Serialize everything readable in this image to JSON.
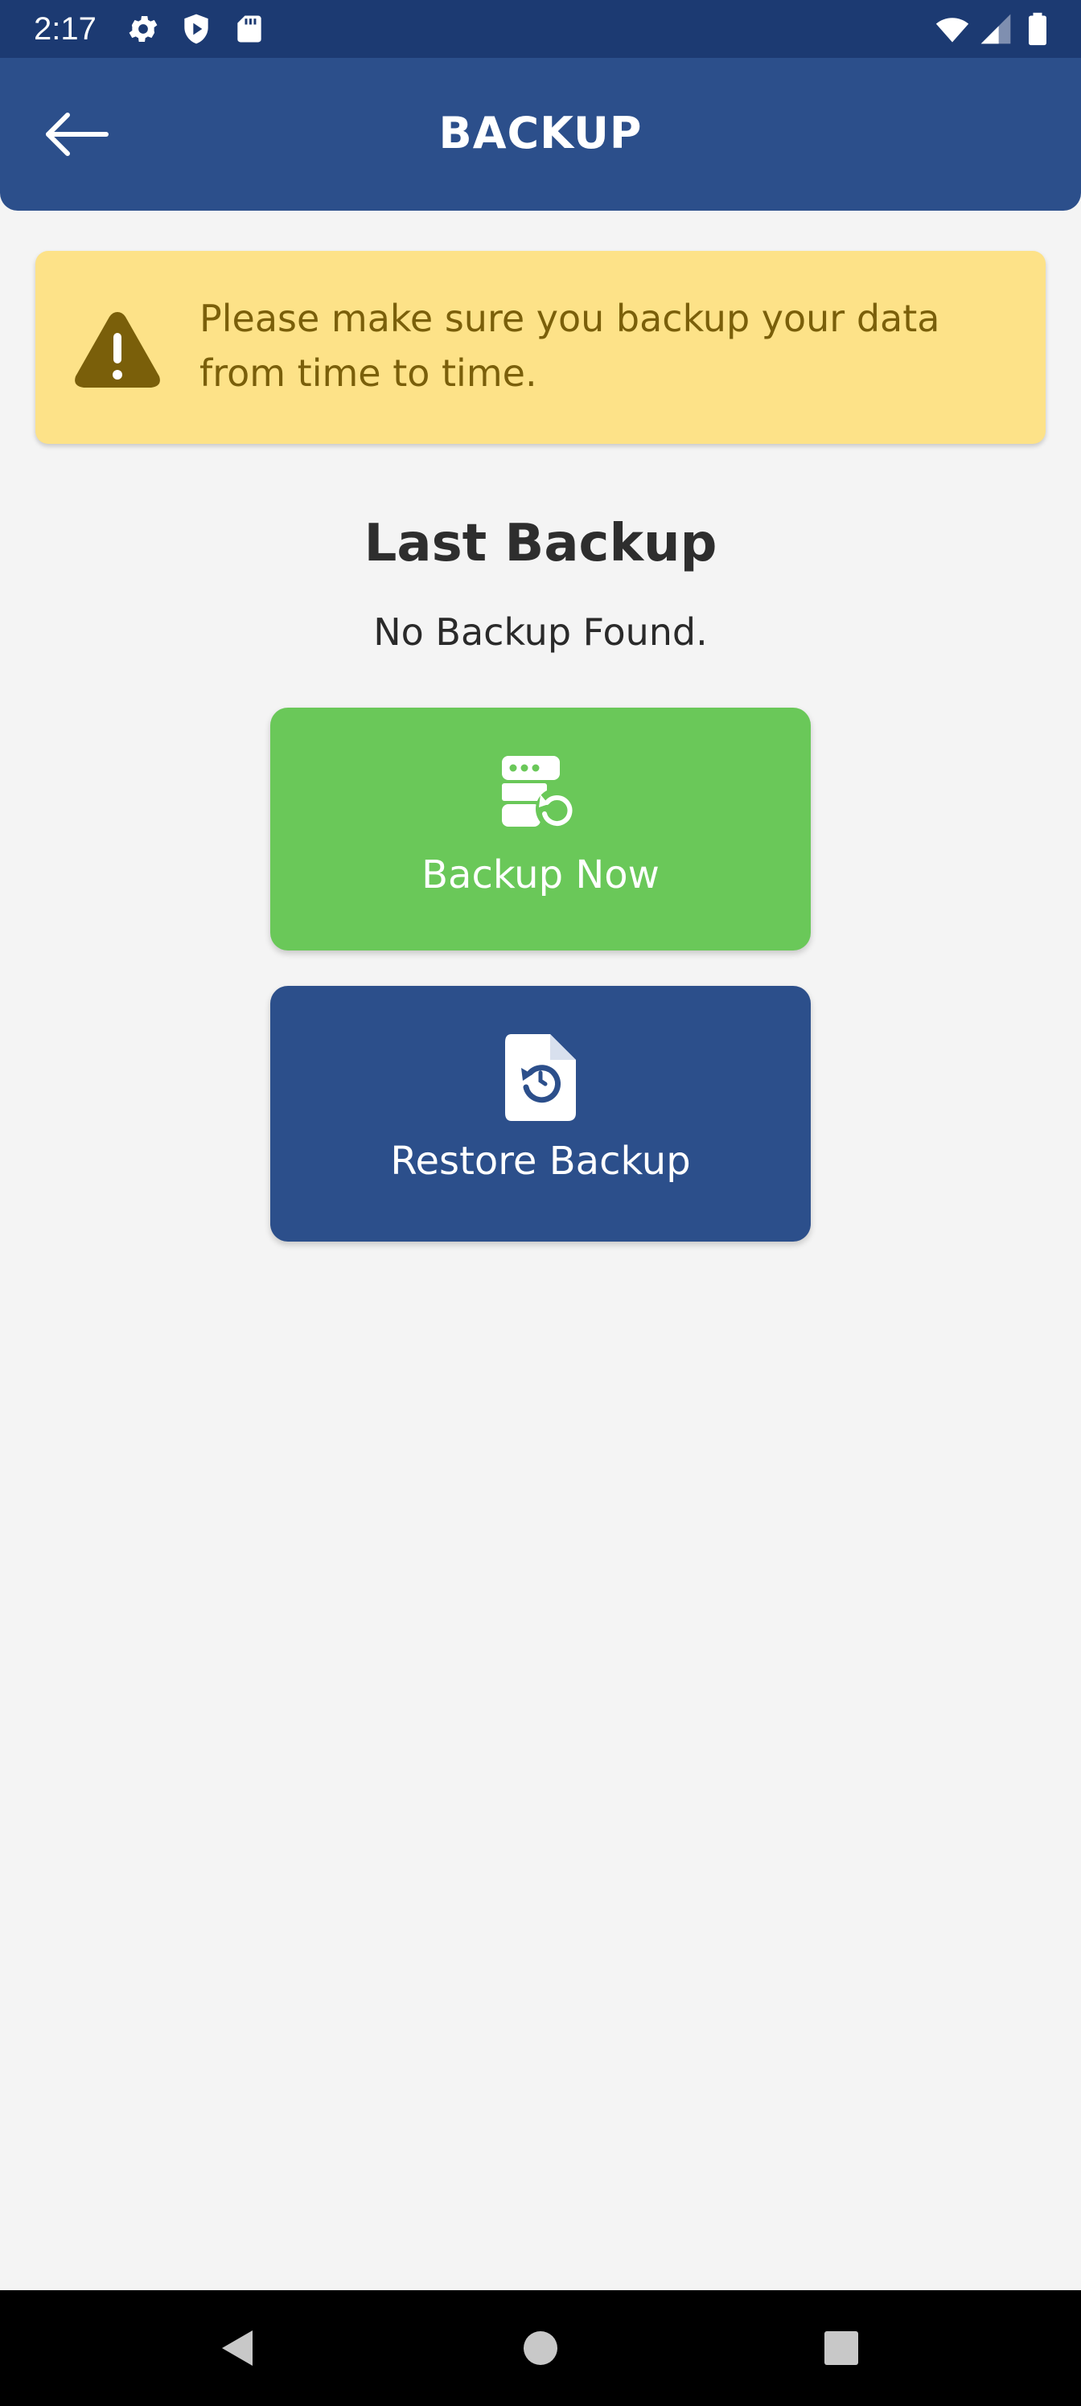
{
  "status_bar": {
    "time": "2:17",
    "icons": [
      "gear-icon",
      "shield-play-icon",
      "sd-card-icon",
      "wifi-icon",
      "cell-signal-icon",
      "battery-icon"
    ]
  },
  "app_bar": {
    "title": "BACKUP",
    "back_icon": "arrow-left-icon"
  },
  "warning": {
    "icon": "warning-triangle-icon",
    "message": "Please make sure you backup your data from time to time."
  },
  "last_backup": {
    "title": "Last Backup",
    "status": "No Backup Found."
  },
  "actions": {
    "backup_now": {
      "label": "Backup Now",
      "icon": "server-restore-icon",
      "color": "#6ac859"
    },
    "restore_backup": {
      "label": "Restore Backup",
      "icon": "file-restore-icon",
      "color": "#2c4f8b"
    }
  },
  "colors": {
    "status_bar": "#1c3a72",
    "app_bar": "#2c4f8b",
    "warning_bg": "#fde288",
    "warning_text": "#7a5f0a",
    "page_bg": "#f4f4f4"
  },
  "nav_bar": {
    "icons": [
      "back-triangle-icon",
      "home-circle-icon",
      "recents-square-icon"
    ]
  }
}
